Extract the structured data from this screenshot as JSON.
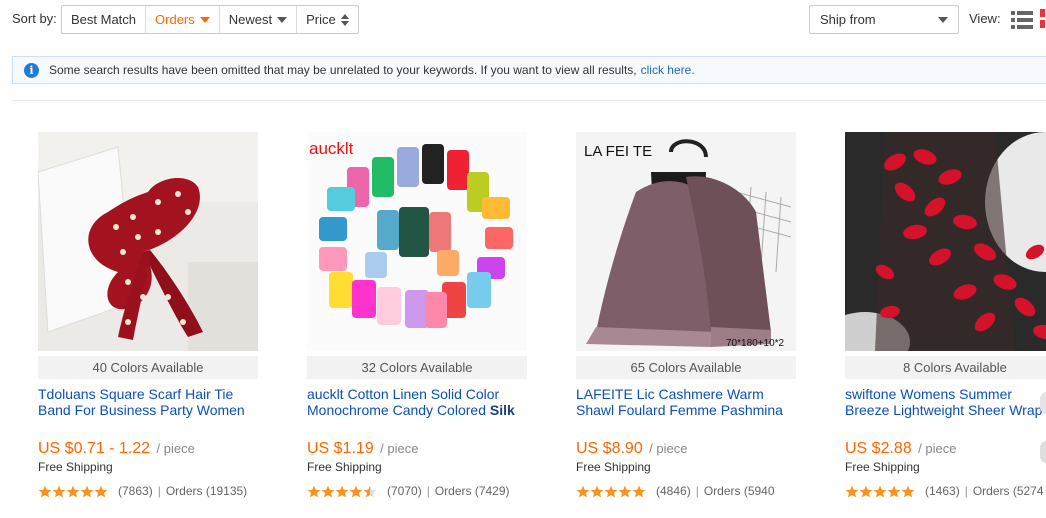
{
  "toolbar": {
    "sort_label": "Sort by:",
    "sort_options": [
      "Best Match",
      "Orders",
      "Newest",
      "Price"
    ],
    "active_sort": "Orders",
    "ship_from": "Ship from",
    "view_label": "View:",
    "accent_color": "#ff6600"
  },
  "notice": {
    "text": "Some search results have been omitted that may be unrelated to your keywords. If you want to view all results,",
    "link": "click here."
  },
  "products": [
    {
      "image_text": "",
      "colors": "40 Colors Available",
      "title_line1": "Tdoluans Square Scarf Hair Tie",
      "title_line2": "Band For Business Party Women",
      "title_bold": "",
      "price": "US $0.71 - 1.22",
      "unit": "/ piece",
      "shipping": "Free Shipping",
      "rating": 5.0,
      "reviews": "(7863)",
      "orders": "Orders (19135)"
    },
    {
      "image_text": "aucklt",
      "colors": "32 Colors Available",
      "title_line1": "aucklt Cotton Linen Solid Color",
      "title_line2": "Monochrome Candy Colored",
      "title_bold": "Silk",
      "price": "US $1.19",
      "unit": "/ piece",
      "shipping": "Free Shipping",
      "rating": 4.5,
      "reviews": "(7070)",
      "orders": "Orders (7429)"
    },
    {
      "image_text": "LA FEI TE",
      "image_caption": "70*180+10*2",
      "colors": "65 Colors Available",
      "title_line1": "LAFEITE Lic Cashmere Warm",
      "title_line2": "Shawl Foulard Femme Pashmina",
      "title_bold": "",
      "price": "US $8.90",
      "unit": "/ piece",
      "shipping": "Free Shipping",
      "rating": 5.0,
      "reviews": "(4846)",
      "orders": "Orders (5940"
    },
    {
      "image_text": "",
      "colors": "8 Colors Available",
      "title_line1": "swiftone Womens Summer",
      "title_line2": "Breeze Lightweight Sheer Wrap",
      "title_bold": "",
      "price": "US $2.88",
      "unit": "/ piece",
      "shipping": "Free Shipping",
      "rating": 5.0,
      "reviews": "(1463)",
      "orders": "Orders (5274"
    }
  ]
}
